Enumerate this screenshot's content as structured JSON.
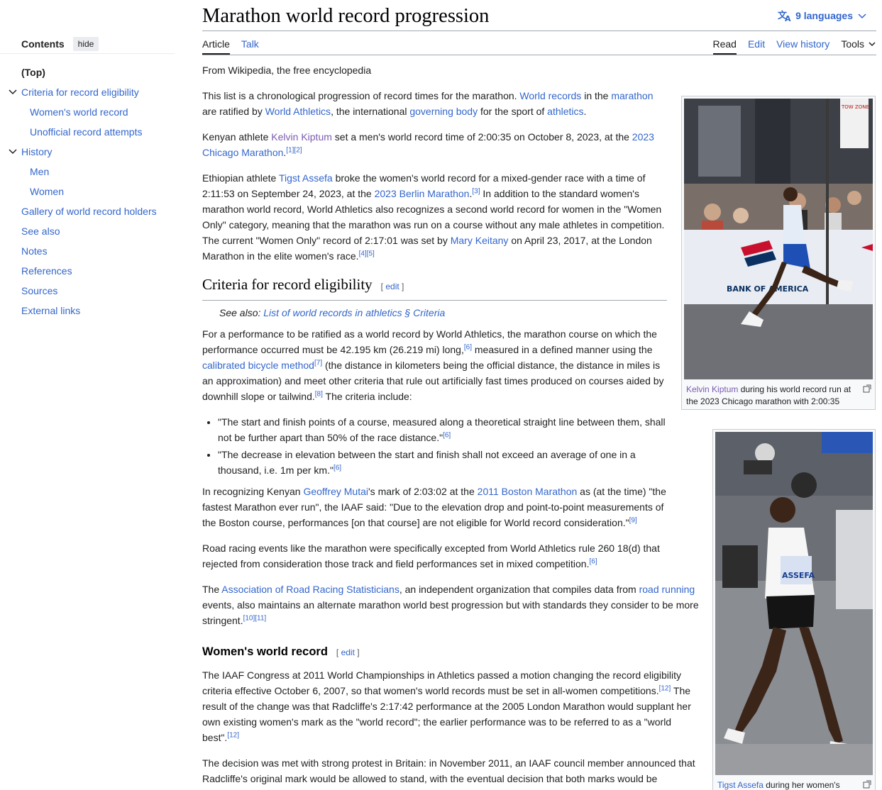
{
  "sidebar": {
    "title": "Contents",
    "hide_label": "hide",
    "items": [
      {
        "label": "(Top)"
      },
      {
        "label": "Criteria for record eligibility"
      },
      {
        "label": "Women's world record"
      },
      {
        "label": "Unofficial record attempts"
      },
      {
        "label": "History"
      },
      {
        "label": "Men"
      },
      {
        "label": "Women"
      },
      {
        "label": "Gallery of world record holders"
      },
      {
        "label": "See also"
      },
      {
        "label": "Notes"
      },
      {
        "label": "References"
      },
      {
        "label": "Sources"
      },
      {
        "label": "External links"
      }
    ]
  },
  "header": {
    "title": "Marathon world record progression",
    "languages": "9 languages",
    "tabs_left": [
      "Article",
      "Talk"
    ],
    "tabs_right": [
      "Read",
      "Edit",
      "View history"
    ],
    "tools": "Tools"
  },
  "article": {
    "sitesub": "From Wikipedia, the free encyclopedia",
    "p1": {
      "t1": "This list is a chronological progression of record times for the marathon. ",
      "l1": "World records",
      "t2": " in the ",
      "l2": "marathon",
      "t3": " are ratified by ",
      "l3": "World Athletics",
      "t4": ", the international ",
      "l4": "governing body",
      "t5": " for the sport of ",
      "l5": "athletics",
      "t6": "."
    },
    "p2": {
      "t1": "Kenyan athlete ",
      "l1": "Kelvin Kiptum",
      "t2": " set a men's world record time of 2:00:35 on October 8, 2023, at the ",
      "l2": "2023 Chicago Marathon",
      "t3": ".",
      "s1": "[1][2]"
    },
    "p3": {
      "t1": "Ethiopian athlete ",
      "l1": "Tigst Assefa",
      "t2": " broke the women's world record for a mixed-gender race with a time of 2:11:53 on September 24, 2023, at the ",
      "l2": "2023 Berlin Marathon",
      "t3": ".",
      "s1": "[3]",
      "t4": " In addition to the standard women's marathon world record, World Athletics also recognizes a second world record for women in the \"Women Only\" category, meaning that the marathon was run on a course without any male athletes in competition. The current \"Women Only\" record of 2:17:01 was set by ",
      "l3": "Mary Keitany",
      "t5": " on April 23, 2017, at the London Marathon in the elite women's race.",
      "s2": "[4][5]"
    },
    "h_criteria": "Criteria for record eligibility",
    "edit_label": "edit",
    "hatnote": {
      "t1": "See also: ",
      "l1": "List of world records in athletics § Criteria"
    },
    "p4": {
      "t1": "For a performance to be ratified as a world record by World Athletics, the marathon course on which the performance occurred must be 42.195 km (26.219 mi) long,",
      "s1": "[6]",
      "t2": " measured in a defined manner using the ",
      "l1": "calibrated bicycle method",
      "s2": "[7]",
      "t3": " (the distance in kilometers being the official distance, the distance in miles is an approximation) and meet other criteria that rule out artificially fast times produced on courses aided by downhill slope or tailwind.",
      "s3": "[8]",
      "t4": " The criteria include:"
    },
    "li1": {
      "t": "\"The start and finish points of a course, measured along a theoretical straight line between them, shall not be further apart than 50% of the race distance.\"",
      "s": "[6]"
    },
    "li2": {
      "t": "\"The decrease in elevation between the start and finish shall not exceed an average of one in a thousand, i.e. 1m per km.\"",
      "s": "[6]"
    },
    "p5": {
      "t1": "In recognizing Kenyan ",
      "l1": "Geoffrey Mutai",
      "t2": "'s mark of 2:03:02 at the ",
      "l2": "2011 Boston Marathon",
      "t3": " as (at the time) \"the fastest Marathon ever run\", the IAAF said: \"Due to the elevation drop and point-to-point measurements of the Boston course, performances [on that course] are not eligible for World record consideration.\"",
      "s1": "[9]"
    },
    "p6": {
      "t1": "Road racing events like the marathon were specifically excepted from World Athletics rule 260 18(d) that rejected from consideration those track and field performances set in mixed competition.",
      "s1": "[6]"
    },
    "p7": {
      "t1": "The ",
      "l1": "Association of Road Racing Statisticians",
      "t2": ", an independent organization that compiles data from ",
      "l2": "road running",
      "t3": " events, also maintains an alternate marathon world best progression but with standards they consider to be more stringent.",
      "s1": "[10][11]"
    },
    "h_women": "Women's world record",
    "p8": {
      "t1": "The IAAF Congress at 2011 World Championships in Athletics passed a motion changing the record eligibility criteria effective October 6, 2007, so that women's world records must be set in all-women competitions.",
      "s1": "[12]",
      "t2": " The result of the change was that Radcliffe's 2:17:42 performance at the 2005 London Marathon would supplant her own existing women's mark as the \"world record\"; the earlier performance was to be referred to as a \"world best\".",
      "s2": "[12]"
    },
    "p9": {
      "t1": "The decision was met with strong protest in Britain: in November 2011, an IAAF council member announced that Radcliffe's original mark would be allowed to stand, with the eventual decision that both marks would be"
    }
  },
  "images": {
    "kiptum": {
      "link": "Kelvin Kiptum",
      "caption": " during his world record run at the 2023 Chicago marathon with 2:00:35",
      "banner": "BANK OF AMERICA",
      "sign": "TOW ZONE"
    },
    "assefa": {
      "link": "Tigst Assefa",
      "caption": " during her women's",
      "bib": "ASSEFA"
    }
  },
  "colors": {
    "link": "#3366cc",
    "visited": "#795cb2",
    "text": "#202122",
    "border": "#a2a9b1"
  }
}
